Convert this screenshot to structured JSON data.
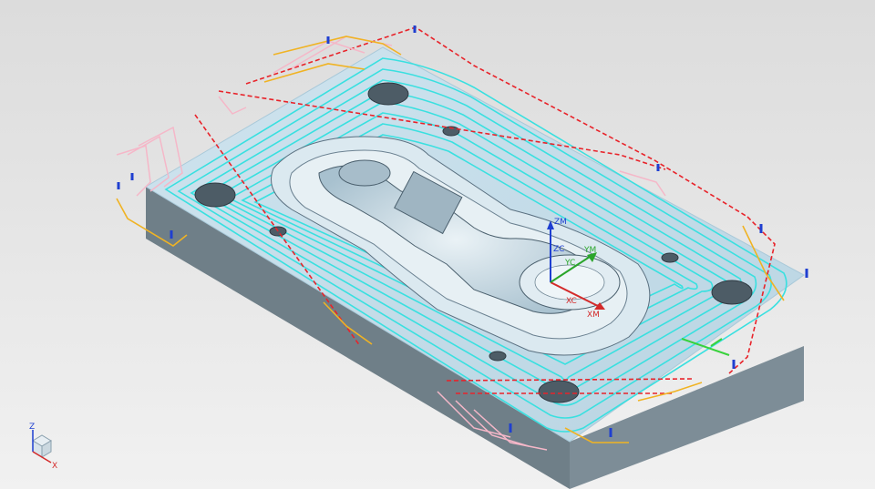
{
  "viewport": {
    "background_top": "#dcdcdc",
    "background_bottom": "#f1f1f1"
  },
  "colors": {
    "part_top": "#c4dde9",
    "part_top_edge": "#a9c9d9",
    "part_side_left": "#6f7f88",
    "part_side_front": "#7f9099",
    "pocket_floor": "#d6e6ee",
    "toolpath_cut": "#39e0e0",
    "toolpath_rapid": "#e8232a",
    "toolpath_engage": "#f5b7c8",
    "toolpath_retract": "#f0b323",
    "toolpath_marker": "#1f3fd0",
    "toolpath_step": "#38d23c",
    "wcs_z": "#1e3fd1",
    "wcs_x": "#d42a2a",
    "wcs_y": "#2aa52a"
  },
  "wcs": {
    "zc_label": "ZC",
    "zm_label": "ZM",
    "yc_label": "YC",
    "ym_label": "YM",
    "xc_label": "XC",
    "xm_label": "XM"
  },
  "view_triad": {
    "z_label": "Z",
    "x_label": "X",
    "icon": "view-cube-icon"
  }
}
